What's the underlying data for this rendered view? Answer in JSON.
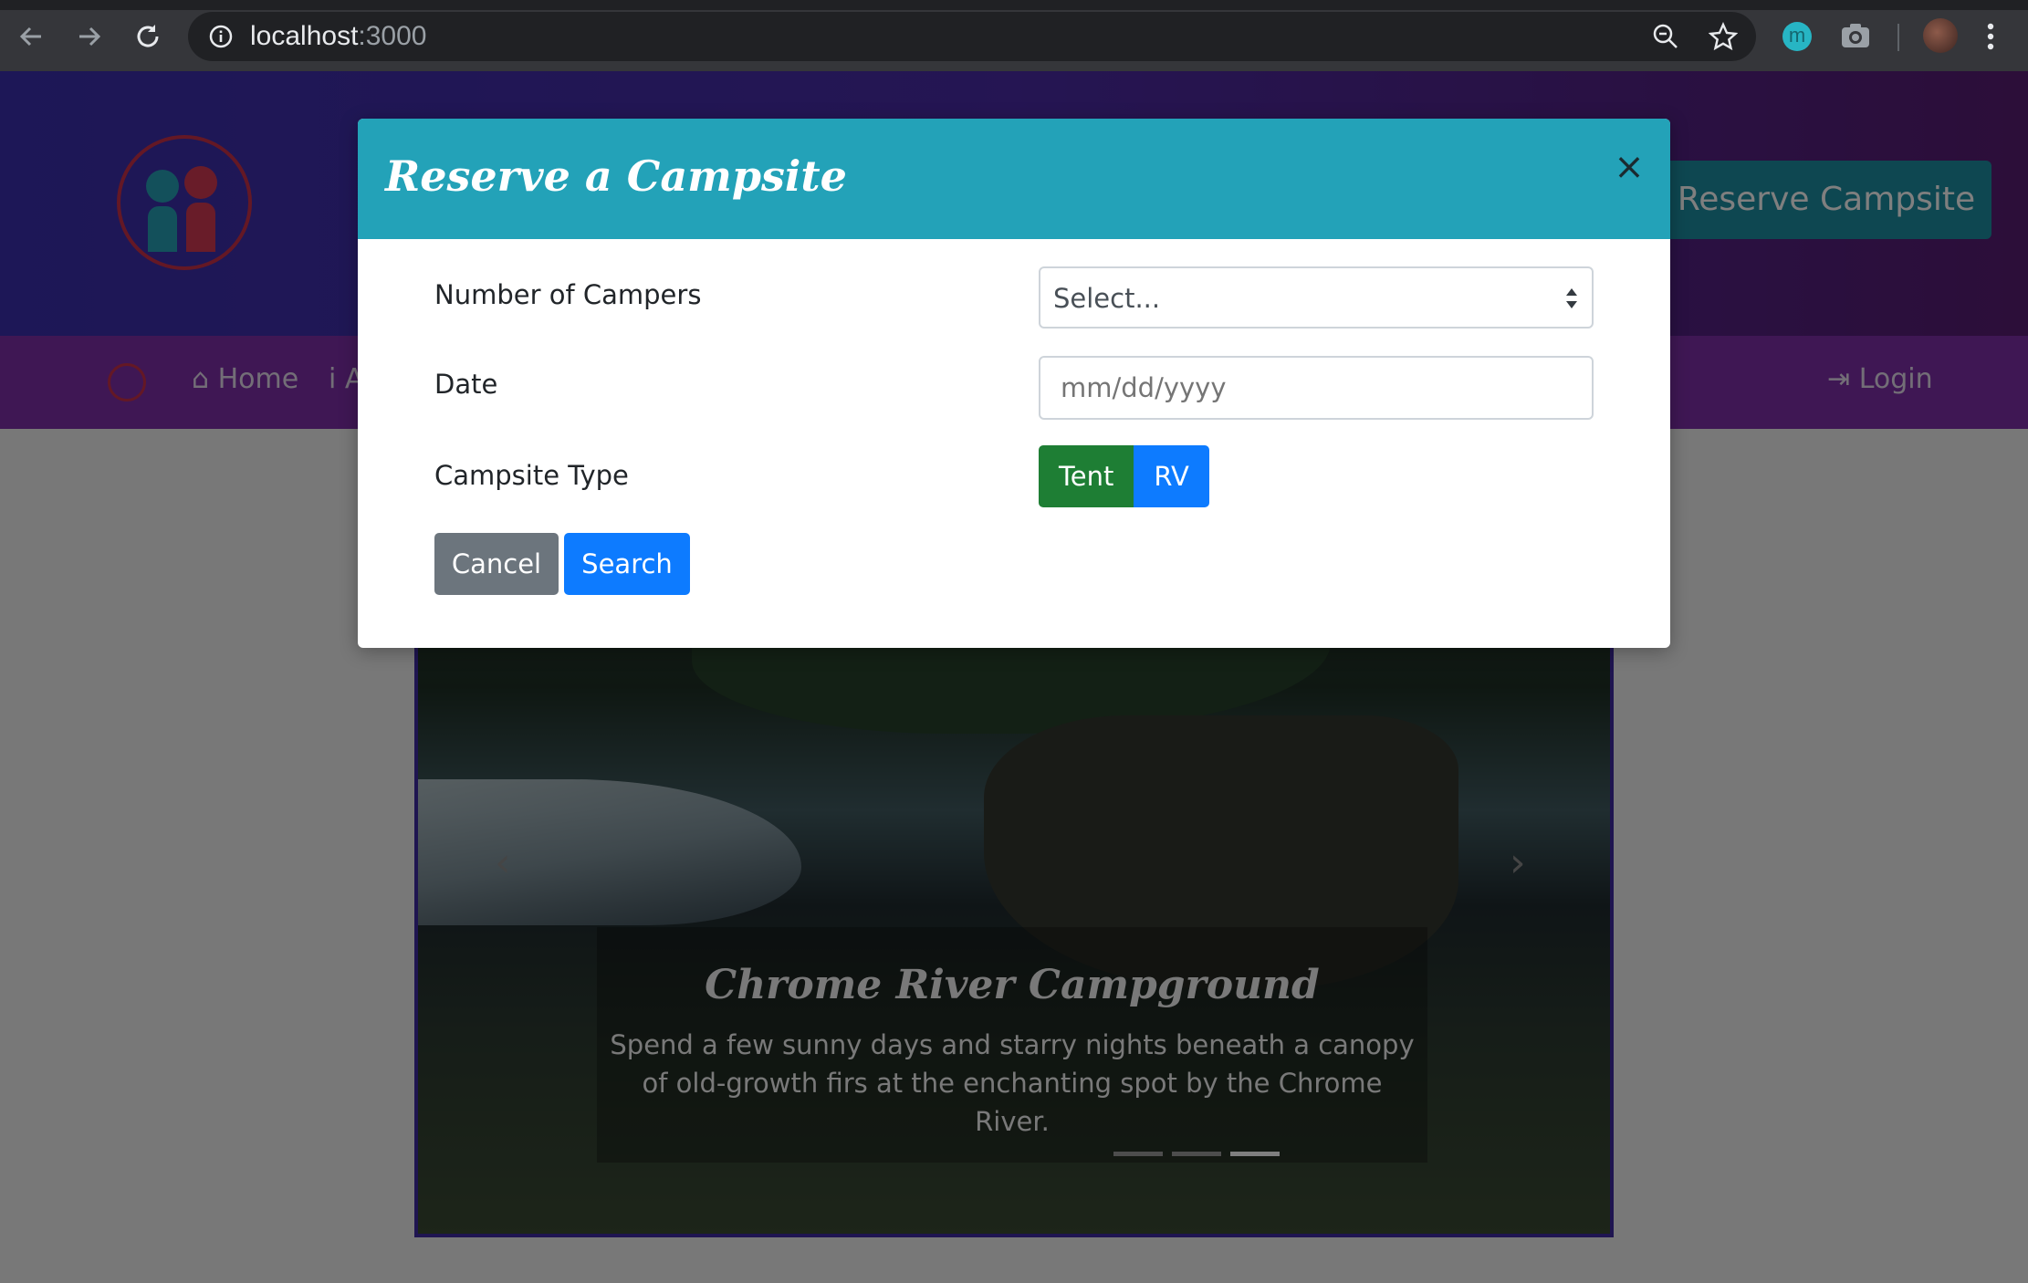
{
  "browser": {
    "url_host": "localhost",
    "url_port": ":3000",
    "extension_badge": "m"
  },
  "header": {
    "reserve_button": "Reserve Campsite"
  },
  "nav": {
    "home": "Home",
    "about_partial": "i A",
    "login": "Login"
  },
  "carousel": {
    "title": "Chrome River Campground",
    "description": "Spend a few sunny days and starry nights beneath a canopy of old-growth firs at the enchanting spot by the Chrome River.",
    "slide_count": 3,
    "active_slide": 3
  },
  "modal": {
    "title": "Reserve a Campsite",
    "close": "×",
    "campers_label": "Number of Campers",
    "campers_value": "Select...",
    "date_label": "Date",
    "date_placeholder": "mm/dd/yyyy",
    "type_label": "Campsite Type",
    "type_options": [
      "Tent",
      "RV"
    ],
    "cancel": "Cancel",
    "search": "Search"
  },
  "colors": {
    "modal_header": "#23a2b8",
    "tent_active": "#1e7e34",
    "primary": "#0d7bff",
    "secondary": "#6c757d",
    "navbar": "#7e2fa8"
  }
}
